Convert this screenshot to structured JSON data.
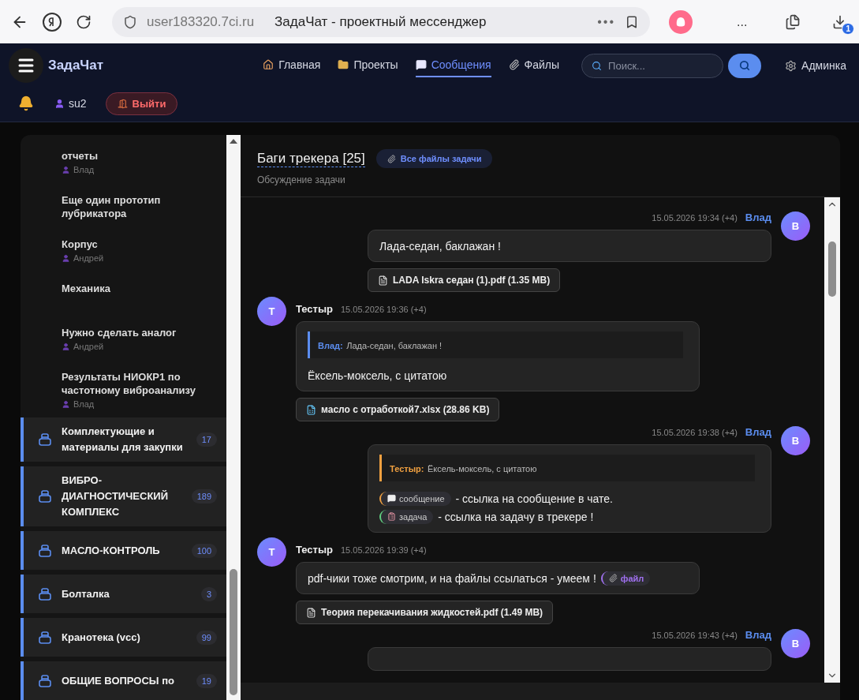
{
  "browser": {
    "url": "user183320.7ci.ru",
    "tab_title": "ЗадаЧат - проектный мессенджер",
    "more": "•••",
    "menu": "...",
    "download_badge": "1"
  },
  "header": {
    "logo": "ЗадаЧат",
    "nav": [
      {
        "kind": "home",
        "label": "Главная",
        "selected": false
      },
      {
        "kind": "projects",
        "label": "Проекты",
        "selected": false
      },
      {
        "kind": "messages",
        "label": "Сообщения",
        "selected": true
      },
      {
        "kind": "files",
        "label": "Файлы",
        "selected": false
      }
    ],
    "search": {
      "placeholder": "Поиск..."
    },
    "admin": "Админка",
    "user": "su2",
    "logout": "Выйти"
  },
  "sidebar": {
    "tasks": [
      {
        "title": "отчеты",
        "author": "Влад"
      },
      {
        "title": "Еще один прототип лубрикатора"
      },
      {
        "title": "Корпус",
        "author": "Андрей"
      },
      {
        "title": "Механика"
      },
      {
        "title": "Нужно сделать аналог",
        "author": "Андрей"
      },
      {
        "title": "Результаты НИОКР1 по частотному виброанализу",
        "author": "Влад"
      }
    ],
    "projects": [
      {
        "name": "Комплектующие и материалы для закупки",
        "count": "17"
      },
      {
        "name": "ВИБРО-ДИАГНОСТИЧЕСКИЙ КОМПЛЕКС",
        "count": "189"
      },
      {
        "name": "МАСЛО-КОНТРОЛЬ",
        "count": "100"
      },
      {
        "name": "Болталка",
        "count": "3"
      },
      {
        "name": "Кранотека (vcc)",
        "count": "99"
      },
      {
        "name": "ОБЩИЕ ВОПРОСЫ по",
        "count": "19"
      }
    ]
  },
  "chat": {
    "title": "Баги трекера [25]",
    "files_button": "Все файлы задачи",
    "subtitle": "Обсуждение задачи",
    "messages": [
      {
        "kind": "outgoing",
        "author": "Влад",
        "avatar": "В",
        "time": "15.05.2026 19:34 (+4)",
        "lines": [
          [
            {
              "text": "Лада-седан, баклажан !"
            }
          ]
        ],
        "attachments": [
          {
            "kind": "pdf",
            "label": "LADA Iskra седан (1).pdf (1.35 MB)"
          }
        ]
      },
      {
        "kind": "incoming",
        "author": "Тестыр",
        "avatar": "Т",
        "time": "15.05.2026 19:36 (+4)",
        "quote": {
          "author": "Влад:",
          "text": "Лада-седан, баклажан !",
          "color": "#5b8def"
        },
        "lines": [
          [
            {
              "text": "Ёксель-моксель, с цитатою"
            }
          ]
        ],
        "attachments": [
          {
            "kind": "xlsx",
            "label": "масло с отработкой7.xlsx (28.86 KB)"
          }
        ]
      },
      {
        "kind": "outgoing",
        "author": "Влад",
        "avatar": "В",
        "time": "15.05.2026 19:38 (+4)",
        "quote": {
          "author": "Тестыр:",
          "text": "Ёксель-моксель, с цитатою",
          "color": "#f0a040"
        },
        "lines": [
          [
            {
              "kind": "message",
              "chip": "сообщение"
            },
            {
              "text": "- ссылка на сообщение в чате."
            }
          ],
          [
            {
              "kind": "task",
              "chip": "задача"
            },
            {
              "text": "- ссылка на задачу в трекере !"
            }
          ]
        ]
      },
      {
        "kind": "incoming",
        "author": "Тестыр",
        "avatar": "Т",
        "time": "15.05.2026 19:39 (+4)",
        "lines": [
          [
            {
              "text": "pdf-чики тоже смотрим, и на файлы ссылаться - умеем !"
            },
            {
              "kind": "file",
              "chip": "файл"
            }
          ]
        ],
        "attachments": [
          {
            "kind": "pdf",
            "label": "Теория перекачивания жидкостей.pdf (1.49 MB)"
          }
        ]
      },
      {
        "kind": "outgoing",
        "author": "Влад",
        "avatar": "В",
        "time": "15.05.2026 19:43 (+4)"
      }
    ]
  }
}
